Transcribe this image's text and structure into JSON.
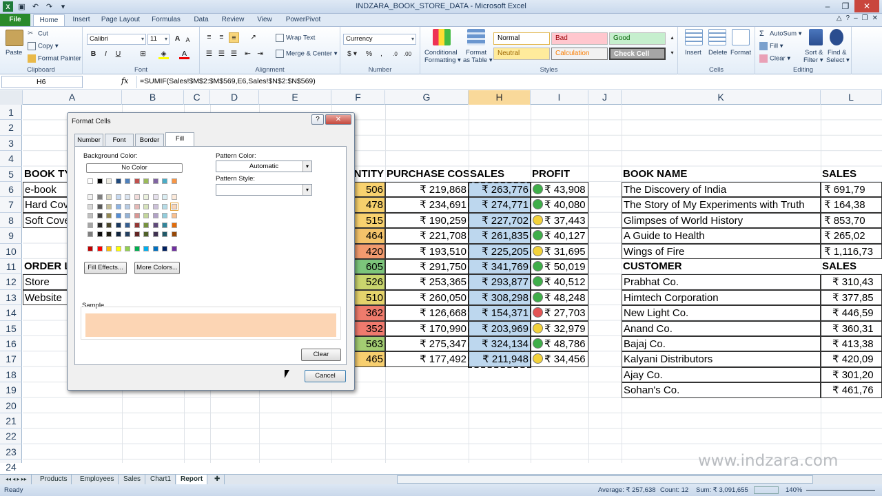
{
  "window": {
    "title": "INDZARA_BOOK_STORE_DATA - Microsoft Excel"
  },
  "tabs": [
    "File",
    "Home",
    "Insert",
    "Page Layout",
    "Formulas",
    "Data",
    "Review",
    "View",
    "PowerPivot"
  ],
  "ribbon": {
    "clipboard": {
      "paste": "Paste",
      "cut": "Cut",
      "copy": "Copy ▾",
      "painter": "Format Painter",
      "label": "Clipboard"
    },
    "font": {
      "name": "Calibri",
      "size": "11",
      "label": "Font",
      "bold": "B",
      "italic": "I",
      "underline": "U",
      "grow": "A",
      "shrink": "A"
    },
    "alignment": {
      "wrap": "Wrap Text",
      "merge": "Merge & Center ▾",
      "label": "Alignment"
    },
    "number": {
      "format": "Currency",
      "label": "Number",
      "currency": "$ ▾",
      "percent": "%",
      "comma": ","
    },
    "styles": {
      "cond": "Conditional",
      "cond2": "Formatting ▾",
      "fmt": "Format",
      "fmt2": "as Table ▾",
      "normal": "Normal",
      "bad": "Bad",
      "good": "Good",
      "neutral": "Neutral",
      "calculation": "Calculation",
      "check": "Check Cell",
      "label": "Styles"
    },
    "cells": {
      "insert": "Insert",
      "delete": "Delete",
      "format": "Format",
      "label": "Cells"
    },
    "editing": {
      "autosum": "AutoSum ▾",
      "fill": "Fill ▾",
      "clear": "Clear ▾",
      "sort": "Sort &",
      "sort2": "Filter ▾",
      "find": "Find &",
      "find2": "Select ▾",
      "label": "Editing"
    }
  },
  "formula_bar": {
    "cell": "H6",
    "fx": "fx",
    "formula": "=SUMIF(Sales!$M$2:$M$569,E6,Sales!$N$2:$N$569)"
  },
  "columns": [
    "A",
    "B",
    "C",
    "D",
    "E",
    "F",
    "G",
    "H",
    "I",
    "J",
    "K",
    "L"
  ],
  "rows": [
    "1",
    "2",
    "3",
    "4",
    "5",
    "6",
    "7",
    "8",
    "9",
    "10",
    "11",
    "12",
    "13",
    "14",
    "15",
    "16",
    "17",
    "18",
    "19",
    "20",
    "21",
    "22",
    "23",
    "24"
  ],
  "table": {
    "headers": {
      "book_type": "BOOK TY",
      "quantity": "NTITY",
      "purchase": "PURCHASE COST",
      "sales": "SALES",
      "profit": "PROFIT"
    },
    "col_a": [
      "e-book",
      "Hard Cov",
      "Soft Cove",
      "",
      "",
      "ORDER LO",
      "Store",
      "Website"
    ],
    "quantity": [
      "506",
      "478",
      "515",
      "464",
      "420",
      "605",
      "526",
      "510",
      "362",
      "352",
      "563",
      "465"
    ],
    "quantity_colors": [
      "#f9d26f",
      "#f6d06c",
      "#f9d26f",
      "#f4c36a",
      "#f29a6e",
      "#7cc57b",
      "#c9d56d",
      "#e5d36c",
      "#ef7b6c",
      "#f07a6e",
      "#a3cd72",
      "#f7cf6f"
    ],
    "purchase": [
      "₹ 219,868",
      "₹ 234,691",
      "₹ 190,259",
      "₹ 221,708",
      "₹ 193,510",
      "₹ 291,750",
      "₹ 253,365",
      "₹ 260,050",
      "₹ 126,668",
      "₹ 170,990",
      "₹ 275,347",
      "₹ 177,492"
    ],
    "sales": [
      "₹ 263,776",
      "₹ 274,771",
      "₹ 227,702",
      "₹ 261,835",
      "₹ 225,205",
      "₹ 341,769",
      "₹ 293,877",
      "₹ 308,298",
      "₹ 154,371",
      "₹ 203,969",
      "₹ 324,134",
      "₹ 211,948"
    ],
    "profit": [
      "₹ 43,908",
      "₹ 40,080",
      "₹ 37,443",
      "₹ 40,127",
      "₹ 31,695",
      "₹ 50,019",
      "₹ 40,512",
      "₹ 48,248",
      "₹ 27,703",
      "₹ 32,979",
      "₹ 48,786",
      "₹ 34,456"
    ],
    "profit_icons": [
      "#3fae49",
      "#3fae49",
      "#f3d23a",
      "#3fae49",
      "#f3d23a",
      "#3fae49",
      "#3fae49",
      "#3fae49",
      "#e45454",
      "#f3d23a",
      "#3fae49",
      "#f3d23a"
    ]
  },
  "books": {
    "h1": "BOOK NAME",
    "h2": "SALES",
    "names": [
      "The Discovery of India",
      "The Story of My Experiments with Truth",
      "Glimpses of World History",
      "A Guide to Health",
      "Wings of Fire"
    ],
    "sales": [
      "₹ 691,79",
      "₹ 164,38",
      "₹ 853,70",
      "₹ 265,02",
      "₹ 1,116,73"
    ]
  },
  "customers": {
    "h1": "CUSTOMER",
    "h2": "SALES",
    "names": [
      "Prabhat Co.",
      "Himtech Corporation",
      "New Light Co.",
      "Anand Co.",
      "Bajaj Co.",
      "Kalyani Distributors",
      "Ajay Co.",
      "Sohan's Co."
    ],
    "sales": [
      "₹ 310,43",
      "₹ 377,85",
      "₹ 446,59",
      "₹ 360,31",
      "₹ 413,38",
      "₹ 420,09",
      "₹ 301,20",
      "₹ 461,76"
    ]
  },
  "dialog": {
    "title": "Format Cells",
    "help": "?",
    "close": "✕",
    "tabs": [
      "Number",
      "Font",
      "Border",
      "Fill"
    ],
    "bg_label": "Background Color:",
    "no_color": "No Color",
    "pattern_color_label": "Pattern Color:",
    "pattern_color": "Automatic",
    "pattern_style_label": "Pattern Style:",
    "fill_effects": "Fill Effects...",
    "more_colors": "More Colors...",
    "sample_label": "Sample",
    "sample_color": "#fcd5b4",
    "clear": "Clear",
    "cancel": "Cancel"
  },
  "sheets": [
    "Products",
    "Employees",
    "Sales",
    "Chart1",
    "Report"
  ],
  "status": {
    "ready": "Ready",
    "average": "Average: ₹ 257,638",
    "count": "Count: 12",
    "sum": "Sum: ₹ 3,091,655",
    "zoom": "140%"
  },
  "watermark": "www.indzara.com"
}
